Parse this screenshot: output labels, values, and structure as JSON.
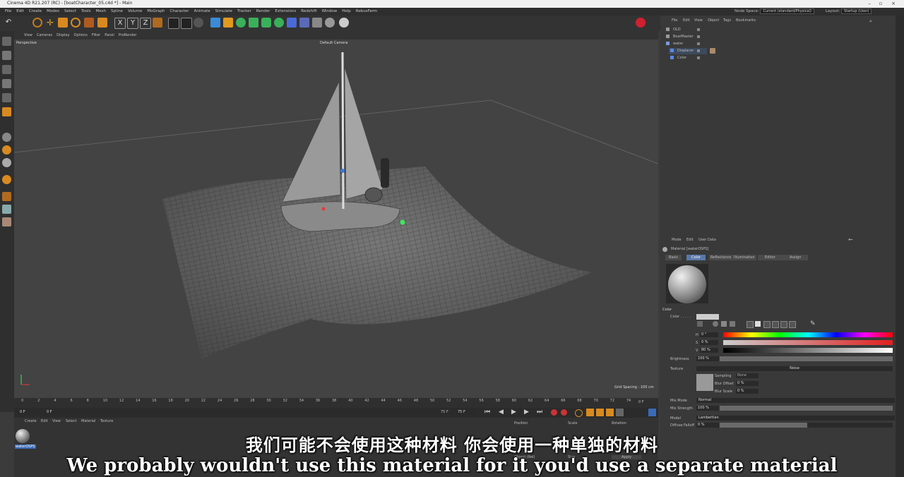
{
  "titlebar": {
    "title": "Cinema 4D R21.207 (RC) - [boatCharacter_05.c4d *] - Main"
  },
  "menubar": {
    "items": [
      "File",
      "Edit",
      "Create",
      "Modes",
      "Select",
      "Tools",
      "Mesh",
      "Spline",
      "Volume",
      "MoGraph",
      "Character",
      "Animate",
      "Simulate",
      "Tracker",
      "Render",
      "Extensions",
      "Redshift",
      "Window",
      "Help",
      "RebusFarm"
    ],
    "node_space_label": "Node Space:",
    "node_space_value": "Current (standard/Physical)",
    "layout_label": "Layout:",
    "layout_value": "Startup (User)"
  },
  "viewport": {
    "menu": [
      "View",
      "Cameras",
      "Display",
      "Options",
      "Filter",
      "Panel",
      "ProRender"
    ],
    "label": "Perspective",
    "camera": "Default Camera",
    "grid_spacing": "Grid Spacing : 100 cm"
  },
  "timeline": {
    "ticks": [
      "0",
      "2",
      "4",
      "6",
      "8",
      "10",
      "12",
      "14",
      "16",
      "18",
      "20",
      "22",
      "24",
      "26",
      "28",
      "30",
      "32",
      "34",
      "36",
      "38",
      "40",
      "42",
      "44",
      "46",
      "48",
      "50",
      "52",
      "54",
      "56",
      "58",
      "60",
      "62",
      "64",
      "66",
      "68",
      "70",
      "72",
      "74"
    ],
    "end": "0 F",
    "start_field": "0 F",
    "current_field": "0 F",
    "end_field": "75 F",
    "end_field2": "75 F"
  },
  "material_manager": {
    "menu": [
      "Create",
      "Edit",
      "View",
      "Select",
      "Material",
      "Texture"
    ],
    "material_name": "waterOSPS"
  },
  "coords": {
    "position": "Position",
    "scale": "Scale",
    "rotation": "Rotation",
    "object_rel": "Object (Rel)",
    "size": "Size",
    "apply": "Apply"
  },
  "object_manager": {
    "menu": [
      "File",
      "Edit",
      "View",
      "Object",
      "Tags",
      "Bookmarks"
    ],
    "objects": [
      "OLD",
      "BoatMaster",
      "water",
      "Displacer",
      "Color"
    ]
  },
  "attributes": {
    "menu": [
      "Mode",
      "Edit",
      "User Data"
    ],
    "material_label": "Material [waterOSPS]",
    "tabs": [
      "Basic",
      "Color",
      "Reflectance",
      "Illumination",
      "Editor",
      "Assign"
    ],
    "active_tab": "Color",
    "section": "Color",
    "color_label": "Color . . . . .",
    "h_label": "H",
    "h_value": "0 °",
    "s_label": "S",
    "s_value": "0 %",
    "v_label": "V",
    "v_value": "80 %",
    "brightness_label": "Brightness",
    "brightness_value": "100 %",
    "texture_label": "Texture",
    "texture_value": "Noise",
    "sampling_label": "Sampling",
    "sampling_value": "None",
    "blur_offset_label": "Blur Offset",
    "blur_offset_value": "0 %",
    "blur_scale_label": "Blur Scale",
    "blur_scale_value": "0 %",
    "mix_mode_label": "Mix Mode",
    "mix_mode_value": "Normal",
    "mix_strength_label": "Mix Strength",
    "mix_strength_value": "100 %",
    "model_label": "Model",
    "model_value": "Lambertian",
    "diffuse_falloff_label": "Diffuse Falloff",
    "diffuse_falloff_value": "0 %"
  },
  "subtitles": {
    "chinese": "我们可能不会使用这种材料 你会使用一种单独的材料",
    "english": "We probably wouldn't use this material for it you'd use a separate material"
  }
}
